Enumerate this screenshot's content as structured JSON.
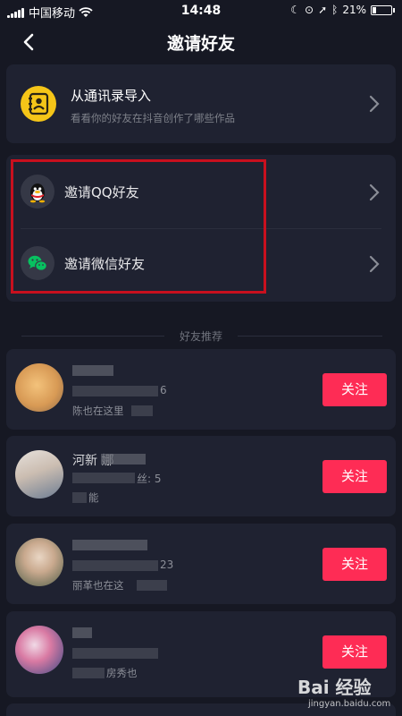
{
  "status_bar": {
    "carrier": "中国移动",
    "time": "14:48",
    "battery": "21%",
    "battery_level": 0.21
  },
  "nav": {
    "title": "邀请好友",
    "back_icon": "chevron-left-icon"
  },
  "contacts_card": {
    "title": "从通讯录导入",
    "subtitle": "看看你的好友在抖音创作了哪些作品",
    "icon": "contacts-book-icon"
  },
  "invite": {
    "qq_label": "邀请QQ好友",
    "wechat_label": "邀请微信好友"
  },
  "section": {
    "title": "好友推荐"
  },
  "friends": [
    {
      "name": "",
      "meta": "6",
      "desc": "陈也在这里",
      "button": "关注"
    },
    {
      "name": "河新 娜",
      "meta": "丝: 5",
      "desc": "能",
      "button": "关注"
    },
    {
      "name": "",
      "meta": "23",
      "desc": "丽革也在这",
      "button": "关注"
    },
    {
      "name": "",
      "meta": "",
      "desc": "房秀也",
      "button": "关注"
    }
  ],
  "watermark": {
    "brand": "Bai 经验",
    "url": "jingyan.baidu.com"
  },
  "colors": {
    "background": "#161823",
    "card": "#1f2231",
    "accent": "#fe2c55",
    "highlight": "#c8101e",
    "contacts_icon": "#f5c518",
    "wechat": "#07c160"
  }
}
